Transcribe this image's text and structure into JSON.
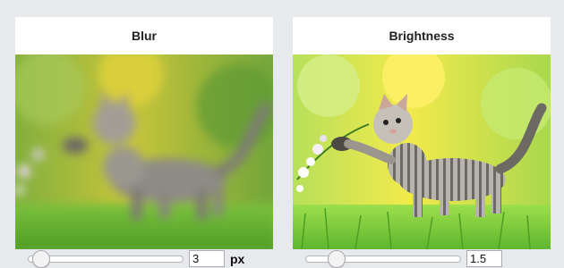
{
  "panels": [
    {
      "title": "Blur",
      "slider": {
        "fraction": 0.06
      },
      "value": "3",
      "unit": "px"
    },
    {
      "title": "Brightness",
      "slider": {
        "fraction": 0.15
      },
      "value": "1.5",
      "unit": ""
    }
  ],
  "icons": {
    "slider-thumb": "circle"
  },
  "colors": {
    "background": "#e9eaee",
    "header": "#ffffff"
  }
}
